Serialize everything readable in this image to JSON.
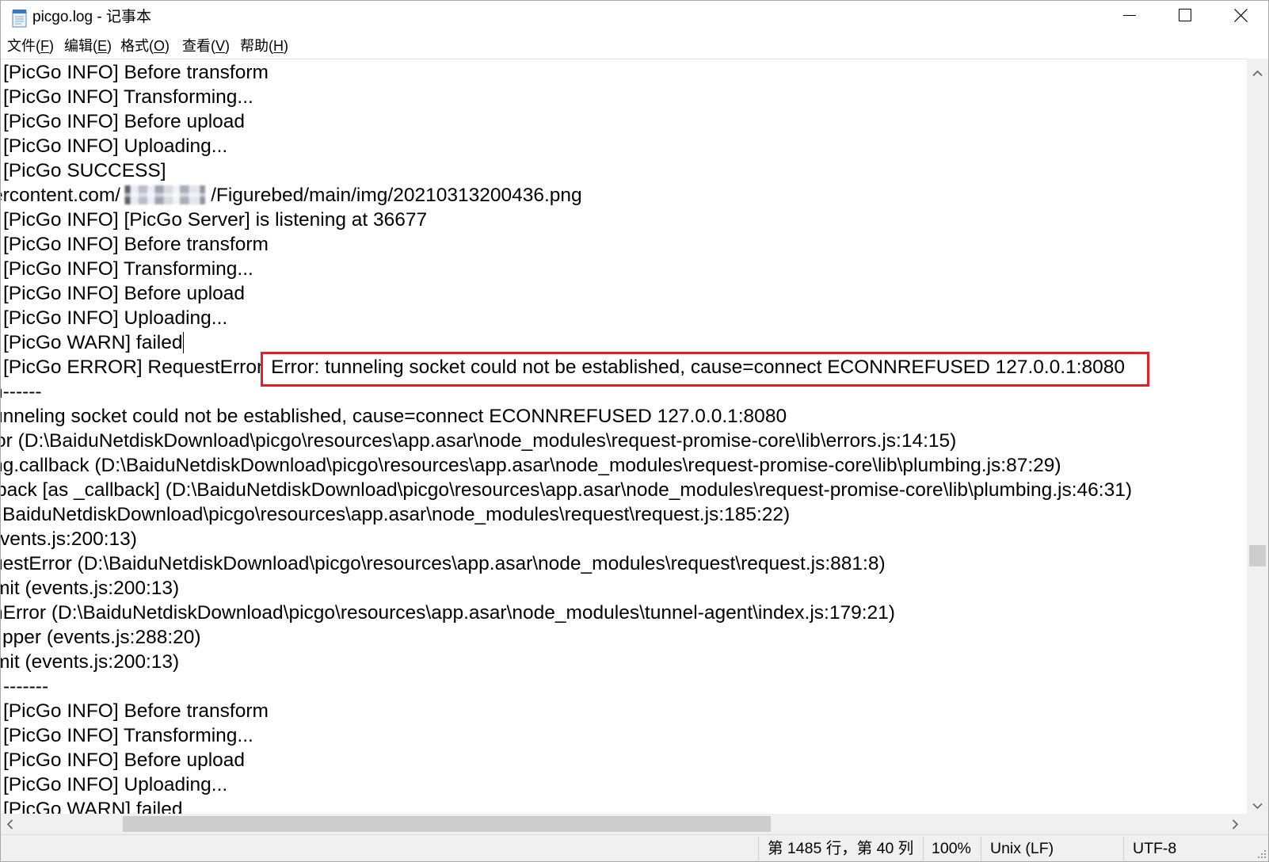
{
  "window": {
    "title": "picgo.log - 记事本",
    "app_icon": "notepad-icon",
    "controls": {
      "minimize": "minimize-icon",
      "maximize": "maximize-icon",
      "close": "close-icon"
    }
  },
  "menu": [
    {
      "prefix": "文件(",
      "key": "F",
      "suffix": ")"
    },
    {
      "prefix": "编辑(",
      "key": "E",
      "suffix": ")"
    },
    {
      "prefix": "格式(",
      "key": "O",
      "suffix": ")"
    },
    {
      "prefix": "查看(",
      "key": "V",
      "suffix": ")"
    },
    {
      "prefix": "帮助(",
      "key": "H",
      "suffix": ")"
    }
  ],
  "editor": {
    "lines": [
      {
        "text": "[PicGo INFO] Before transform"
      },
      {
        "text": "[PicGo INFO] Transforming..."
      },
      {
        "text": "[PicGo INFO] Before upload"
      },
      {
        "text": "[PicGo INFO] Uploading..."
      },
      {
        "text": "[PicGo SUCCESS]"
      },
      {
        "text": "ercontent.com/",
        "text_after_redaction": "/Figurebed/main/img/20210313200436.png"
      },
      {
        "text": "[PicGo INFO] [PicGo Server] is listening at 36677"
      },
      {
        "text": "[PicGo INFO] Before transform"
      },
      {
        "text": "[PicGo INFO] Transforming..."
      },
      {
        "text": "[PicGo INFO] Before upload"
      },
      {
        "text": "[PicGo INFO] Uploading..."
      },
      {
        "text": "[PicGo WARN] failed"
      },
      {
        "text": "[PicGo ERROR] RequestError",
        "highlighted_text": "Error: tunneling socket could not be established, cause=connect ECONNREFUSED 127.0.0.1:8080"
      },
      {
        "text": "n------"
      },
      {
        "text": "unneling socket could not be established, cause=connect ECONNREFUSED 127.0.0.1:8080"
      },
      {
        "text": "or (D:\\BaiduNetdiskDownload\\picgo\\resources\\app.asar\\node_modules\\request-promise-core\\lib\\errors.js:14:15)"
      },
      {
        "text": "ng.callback (D:\\BaiduNetdiskDownload\\picgo\\resources\\app.asar\\node_modules\\request-promise-core\\lib\\plumbing.js:87:29)"
      },
      {
        "text": "back [as _callback] (D:\\BaiduNetdiskDownload\\picgo\\resources\\app.asar\\node_modules\\request-promise-core\\lib\\plumbing.js:46:31)"
      },
      {
        "text": "BaiduNetdiskDownload\\picgo\\resources\\app.asar\\node_modules\\request\\request.js:185:22)"
      },
      {
        "text": "vents.js:200:13)"
      },
      {
        "text": "uestError (D:\\BaiduNetdiskDownload\\picgo\\resources\\app.asar\\node_modules\\request\\request.js:881:8)"
      },
      {
        "text": "mit (events.js:200:13)"
      },
      {
        "text": "nError (D:\\BaiduNetdiskDownload\\picgo\\resources\\app.asar\\node_modules\\tunnel-agent\\index.js:179:21)"
      },
      {
        "text": "pper (events.js:288:20)"
      },
      {
        "text": "mit (events.js:200:13)"
      },
      {
        "text": "-------"
      },
      {
        "text": "[PicGo INFO] Before transform"
      },
      {
        "text": "[PicGo INFO] Transforming..."
      },
      {
        "text": "[PicGo INFO] Before upload"
      },
      {
        "text": "[PicGo INFO] Uploading..."
      },
      {
        "text": "[PicGo WARN] failed"
      }
    ]
  },
  "status_bar": {
    "position": "第 1485 行，第 40 列",
    "zoom": "100%",
    "line_ending": "Unix (LF)",
    "encoding": "UTF-8"
  },
  "icons": {
    "scroll_up": "chevron-up-icon",
    "scroll_down": "chevron-down-icon",
    "scroll_left": "chevron-left-icon",
    "scroll_right": "chevron-right-icon",
    "resize_grip": "resize-grip-icon"
  },
  "colors": {
    "annotation_box": "#e0202a",
    "text": "#000000",
    "editor_background": "#ffffff",
    "chrome_background": "#f0f0f0",
    "scrollbar_thumb": "#cdcdcd"
  }
}
